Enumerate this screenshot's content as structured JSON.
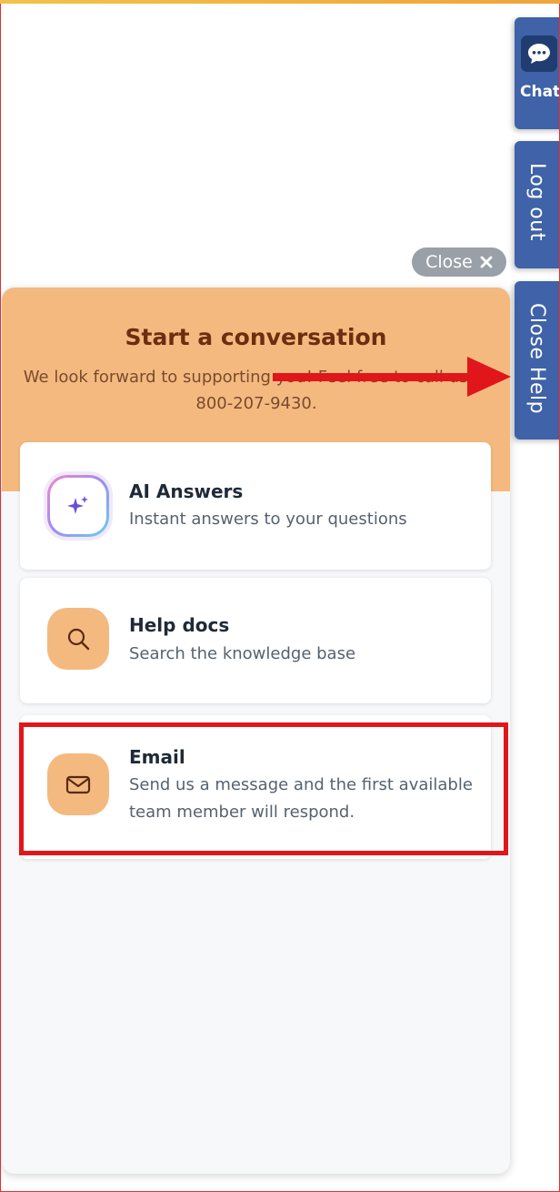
{
  "side_tabs": {
    "chat_label": "Chat",
    "logout_label": "Log out",
    "close_help_label": "Close Help"
  },
  "close_pill": {
    "label": "Close",
    "icon": "close-x-icon"
  },
  "panel": {
    "title": "Start a conversation",
    "subtitle_line1": "We look forward to supporting you! Feel free to call us at",
    "subtitle_line2": "800-207-9430.",
    "options": [
      {
        "title": "AI Answers",
        "description": "Instant answers to your questions",
        "icon": "sparkles-icon"
      },
      {
        "title": "Help docs",
        "description": "Search the knowledge base",
        "icon": "search-icon"
      },
      {
        "title": "Email",
        "description_line1": "Send us a message and the first available",
        "description_line2": "team member will respond.",
        "icon": "mail-icon"
      }
    ]
  },
  "colors": {
    "accent": "#f4b97f",
    "tab_blue": "#3f62a8",
    "annotation_red": "#e0161b"
  }
}
